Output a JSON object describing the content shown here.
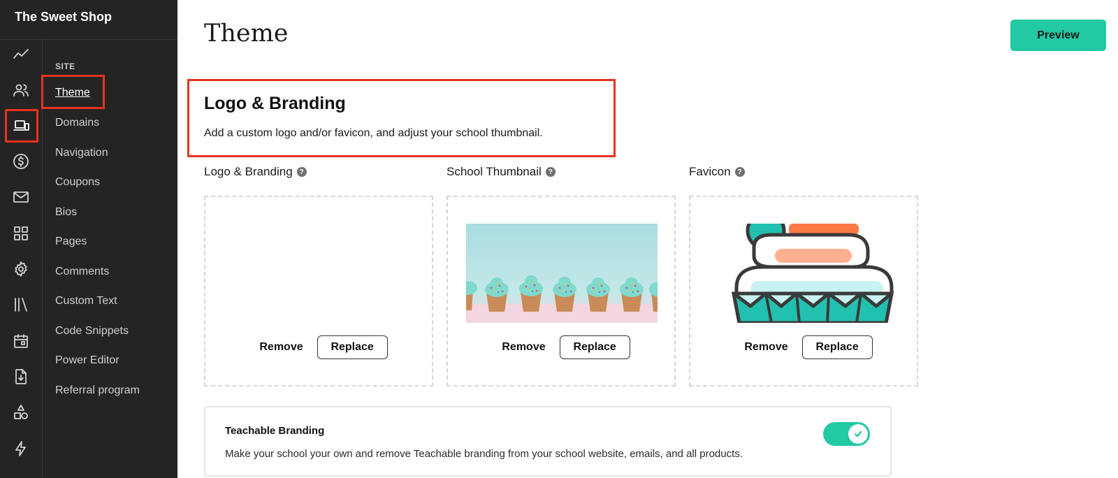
{
  "sidebar": {
    "school_name": "The Sweet Shop",
    "rail_icons": [
      "activity-icon",
      "users-icon",
      "site-devices-icon",
      "dollar-icon",
      "mail-icon",
      "grid-icon",
      "gear-icon",
      "library-icon",
      "calendar-icon",
      "file-download-icon",
      "shapes-icon",
      "lightning-icon"
    ],
    "active_rail_icon": "site-devices-icon",
    "section_label": "SITE",
    "items": [
      {
        "label": "Theme",
        "active": true
      },
      {
        "label": "Domains"
      },
      {
        "label": "Navigation"
      },
      {
        "label": "Coupons"
      },
      {
        "label": "Bios"
      },
      {
        "label": "Pages"
      },
      {
        "label": "Comments"
      },
      {
        "label": "Custom Text"
      },
      {
        "label": "Code Snippets"
      },
      {
        "label": "Power Editor"
      },
      {
        "label": "Referral program"
      }
    ]
  },
  "header": {
    "title": "Theme",
    "preview_label": "Preview"
  },
  "logo_branding": {
    "title": "Logo & Branding",
    "description": "Add a custom logo and/or favicon, and adjust your school thumbnail.",
    "cards": [
      {
        "label": "Logo & Branding",
        "remove_label": "Remove",
        "replace_label": "Replace",
        "image": "empty"
      },
      {
        "label": "School Thumbnail",
        "remove_label": "Remove",
        "replace_label": "Replace",
        "image": "cupcakes-photo"
      },
      {
        "label": "Favicon",
        "remove_label": "Remove",
        "replace_label": "Replace",
        "image": "cupcake-icon"
      }
    ]
  },
  "teachable_branding": {
    "title": "Teachable Branding",
    "description": "Make your school your own and remove Teachable branding from your school website, emails, and all products.",
    "toggle_on": true
  },
  "colors": {
    "accent": "#22c9a2",
    "highlight": "#e8321e",
    "sidebar_bg": "#242424"
  }
}
